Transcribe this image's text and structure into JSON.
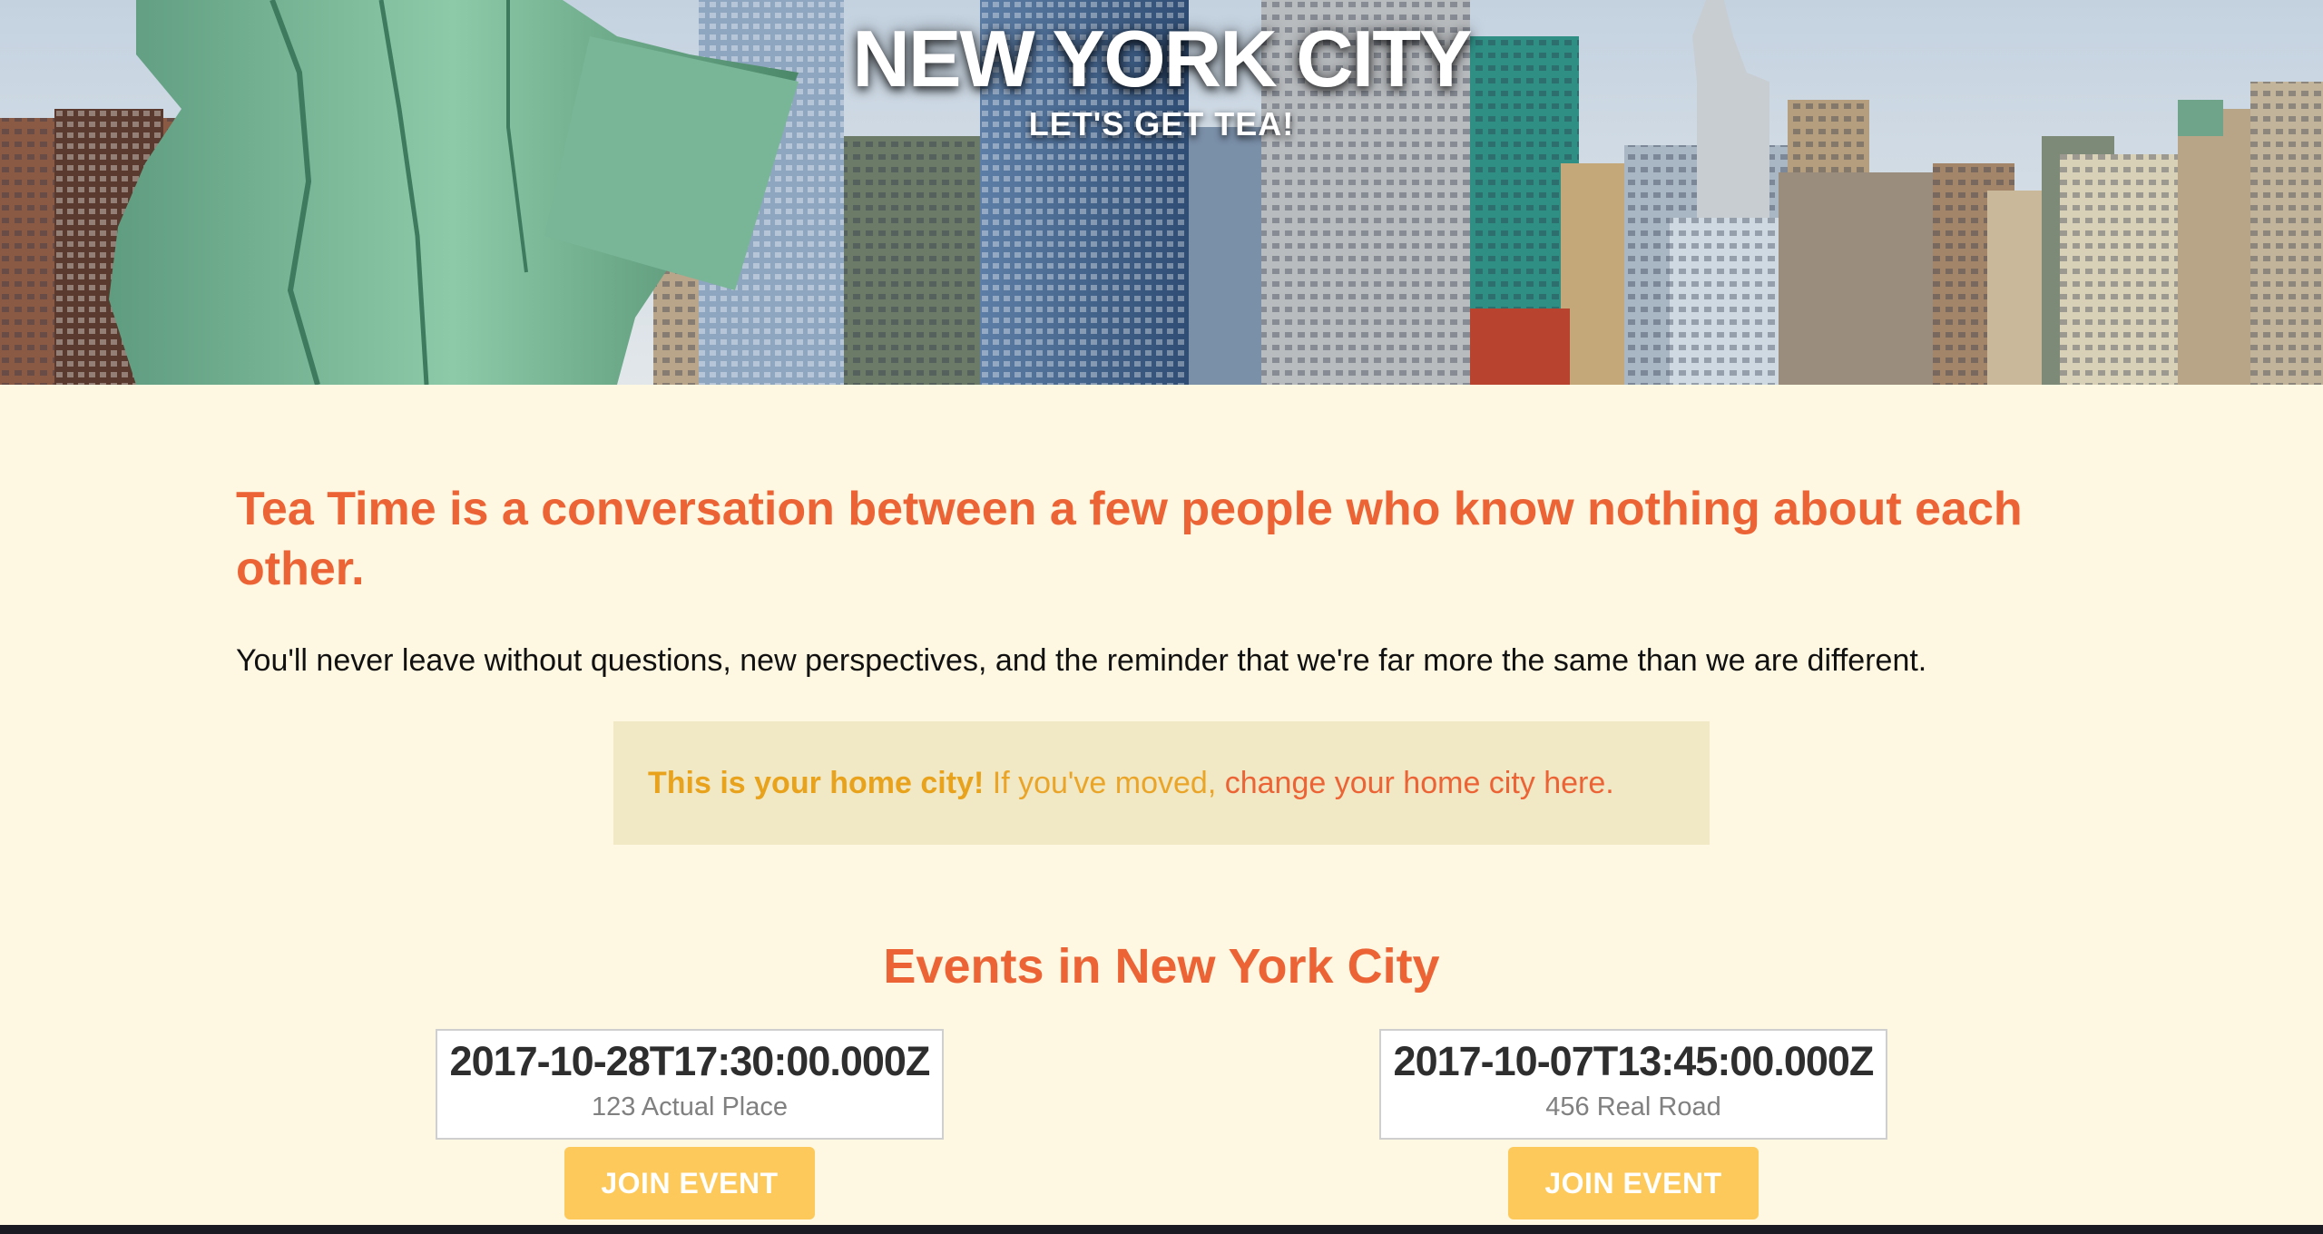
{
  "hero": {
    "title": "NEW YORK CITY",
    "subtitle": "LET'S GET TEA!"
  },
  "intro": {
    "heading": "Tea Time is a conversation between a few people who know nothing about each other.",
    "body": "You'll never leave without questions, new perspectives, and the reminder that we're far more the same than we are different."
  },
  "notice": {
    "strong": "This is your home city!",
    "text": " If you've moved, ",
    "link": "change your home city here."
  },
  "events": {
    "heading": "Events in New York City",
    "items": [
      {
        "date": "2017-10-28T17:30:00.000Z",
        "place": "123 Actual Place",
        "button": "JOIN EVENT"
      },
      {
        "date": "2017-10-07T13:45:00.000Z",
        "place": "456 Real Road",
        "button": "JOIN EVENT"
      }
    ]
  },
  "colors": {
    "accent": "#ec6335",
    "notice_bg": "#f1e9c6",
    "notice_text": "#e8a21c",
    "button": "#fdc95a",
    "page_bg": "#fef7e1"
  }
}
